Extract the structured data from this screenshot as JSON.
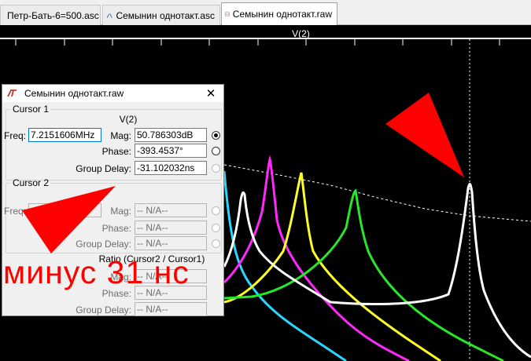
{
  "tabs": [
    {
      "label": "Петр-Бать-6=500.asc",
      "icon": "schematic-icon"
    },
    {
      "label": "Семынин однотакт.asc",
      "icon": "schematic-icon"
    },
    {
      "label": "Семынин однотакт.raw",
      "icon": "waveform-icon",
      "active": true
    }
  ],
  "plot": {
    "trace_title": "V(2)"
  },
  "dialog": {
    "title": "Семынин однотакт.raw",
    "close": "✕",
    "cursor1": {
      "group_label": "Cursor 1",
      "trace": "V(2)",
      "freq_label": "Freq:",
      "freq_value": "7.2151606MHz",
      "mag_label": "Mag:",
      "mag_value": "50.786303dB",
      "phase_label": "Phase:",
      "phase_value": "-393.4537°",
      "gd_label": "Group Delay:",
      "gd_value": "-31.102032ns"
    },
    "cursor2": {
      "group_label": "Cursor 2",
      "freq_label": "Freq:",
      "mag_label": "Mag:",
      "mag_value": "-- N/A--",
      "phase_label": "Phase:",
      "phase_value": "-- N/A--",
      "gd_label": "Group Delay:",
      "gd_value": "-- N/A--"
    },
    "ratio": {
      "label": "Ratio (Cursor2 / Cursor1)",
      "mag_label": "Mag:",
      "mag_value": "-- N/A--",
      "phase_label": "Phase:",
      "phase_value": "-- N/A--",
      "gd_label": "Group Delay:",
      "gd_value": "-- N/A--"
    }
  },
  "annotation": {
    "text": "минус 31 нс",
    "color": "#ff0000"
  },
  "colors": {
    "cyan": "#28d7ff",
    "magenta": "#ff28ff",
    "yellow": "#ffff28",
    "green": "#28e628",
    "white": "#ffffff"
  }
}
